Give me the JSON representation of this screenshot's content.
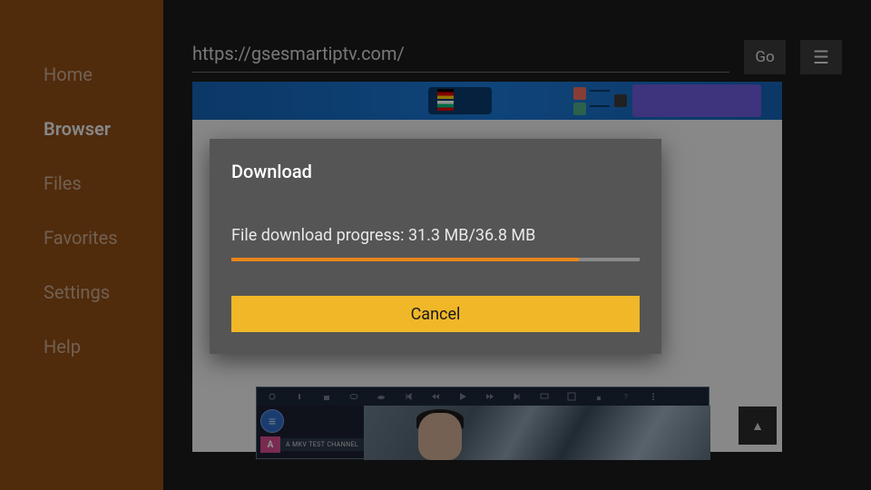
{
  "sidebar": {
    "items": [
      {
        "label": "Home",
        "active": false
      },
      {
        "label": "Browser",
        "active": true
      },
      {
        "label": "Files",
        "active": false
      },
      {
        "label": "Favorites",
        "active": false
      },
      {
        "label": "Settings",
        "active": false
      },
      {
        "label": "Help",
        "active": false
      }
    ]
  },
  "addressbar": {
    "url": "https://gsesmartiptv.com/",
    "go_label": "Go",
    "menu_glyph": "☰"
  },
  "player": {
    "hamburger_glyph": "≡",
    "row_badge": "A",
    "row_label": "A MKV TEST CHANNEL"
  },
  "back_to_top_glyph": "▲",
  "dialog": {
    "title": "Download",
    "progress_prefix": "File download progress: ",
    "downloaded": "31.3 MB",
    "separator": "/",
    "total": "36.8 MB",
    "progress_percent": 85,
    "cancel_label": "Cancel"
  }
}
